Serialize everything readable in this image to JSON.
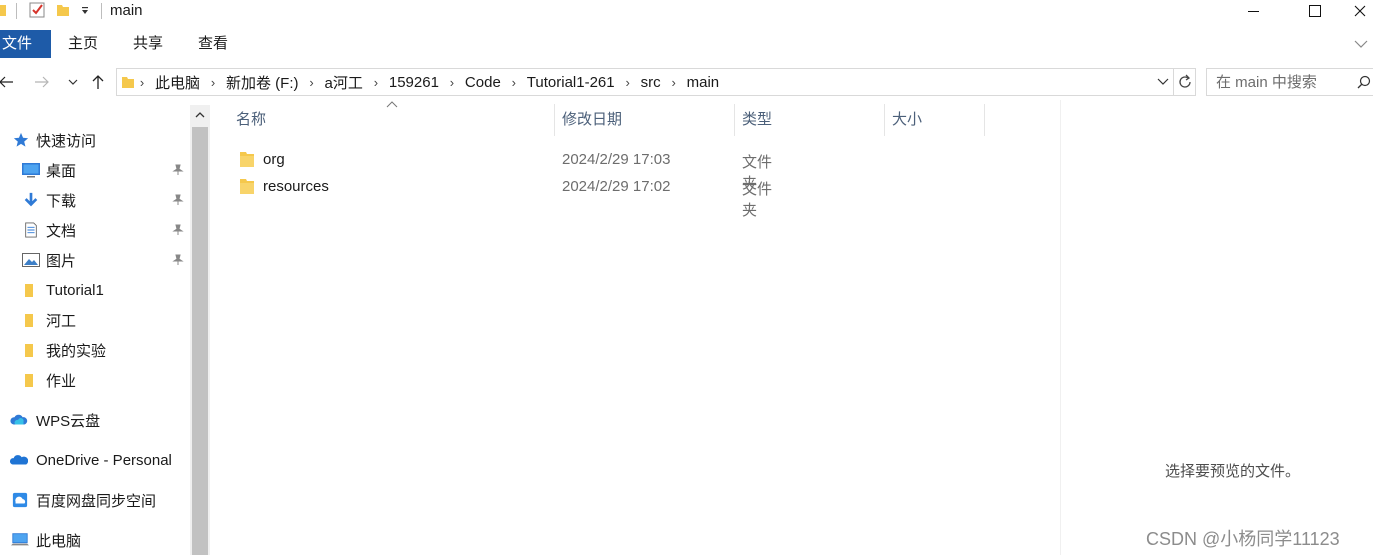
{
  "window": {
    "title": "main"
  },
  "ribbon": {
    "tabs": [
      {
        "label": "文件"
      },
      {
        "label": "主页"
      },
      {
        "label": "共享"
      },
      {
        "label": "查看"
      }
    ]
  },
  "address": {
    "breadcrumbs": [
      "此电脑",
      "新加卷 (F:)",
      "a河工",
      "159261",
      "Code",
      "Tutorial1-261",
      "src",
      "main"
    ]
  },
  "search": {
    "placeholder": "在 main 中搜索"
  },
  "sidebar": {
    "items": [
      {
        "label": "快速访问",
        "icon": "star-icon"
      },
      {
        "label": "桌面",
        "icon": "desktop-icon",
        "pinned": true
      },
      {
        "label": "下载",
        "icon": "download-icon",
        "pinned": true
      },
      {
        "label": "文档",
        "icon": "document-icon",
        "pinned": true
      },
      {
        "label": "图片",
        "icon": "pictures-icon",
        "pinned": true
      },
      {
        "label": "Tutorial1",
        "icon": "folder-icon"
      },
      {
        "label": "河工",
        "icon": "folder-icon"
      },
      {
        "label": "我的实验",
        "icon": "folder-icon"
      },
      {
        "label": "作业",
        "icon": "folder-icon"
      },
      {
        "label": "WPS云盘",
        "icon": "cloud-icon"
      },
      {
        "label": "OneDrive - Personal",
        "icon": "onedrive-icon"
      },
      {
        "label": "百度网盘同步空间",
        "icon": "baidu-netdisk-icon"
      },
      {
        "label": "此电脑",
        "icon": "computer-icon"
      }
    ]
  },
  "filelist": {
    "columns": [
      "名称",
      "修改日期",
      "类型",
      "大小"
    ],
    "rows": [
      {
        "name": "org",
        "date": "2024/2/29 17:03",
        "type": "文件夹",
        "size": ""
      },
      {
        "name": "resources",
        "date": "2024/2/29 17:02",
        "type": "文件夹",
        "size": ""
      }
    ]
  },
  "preview": {
    "message": "选择要预览的文件。"
  },
  "watermark": "CSDN @小杨同学11123",
  "colors": {
    "file_tab": "#1e5ba8",
    "folder_yellow": "#f5c84c",
    "header_text": "#4c607a"
  }
}
